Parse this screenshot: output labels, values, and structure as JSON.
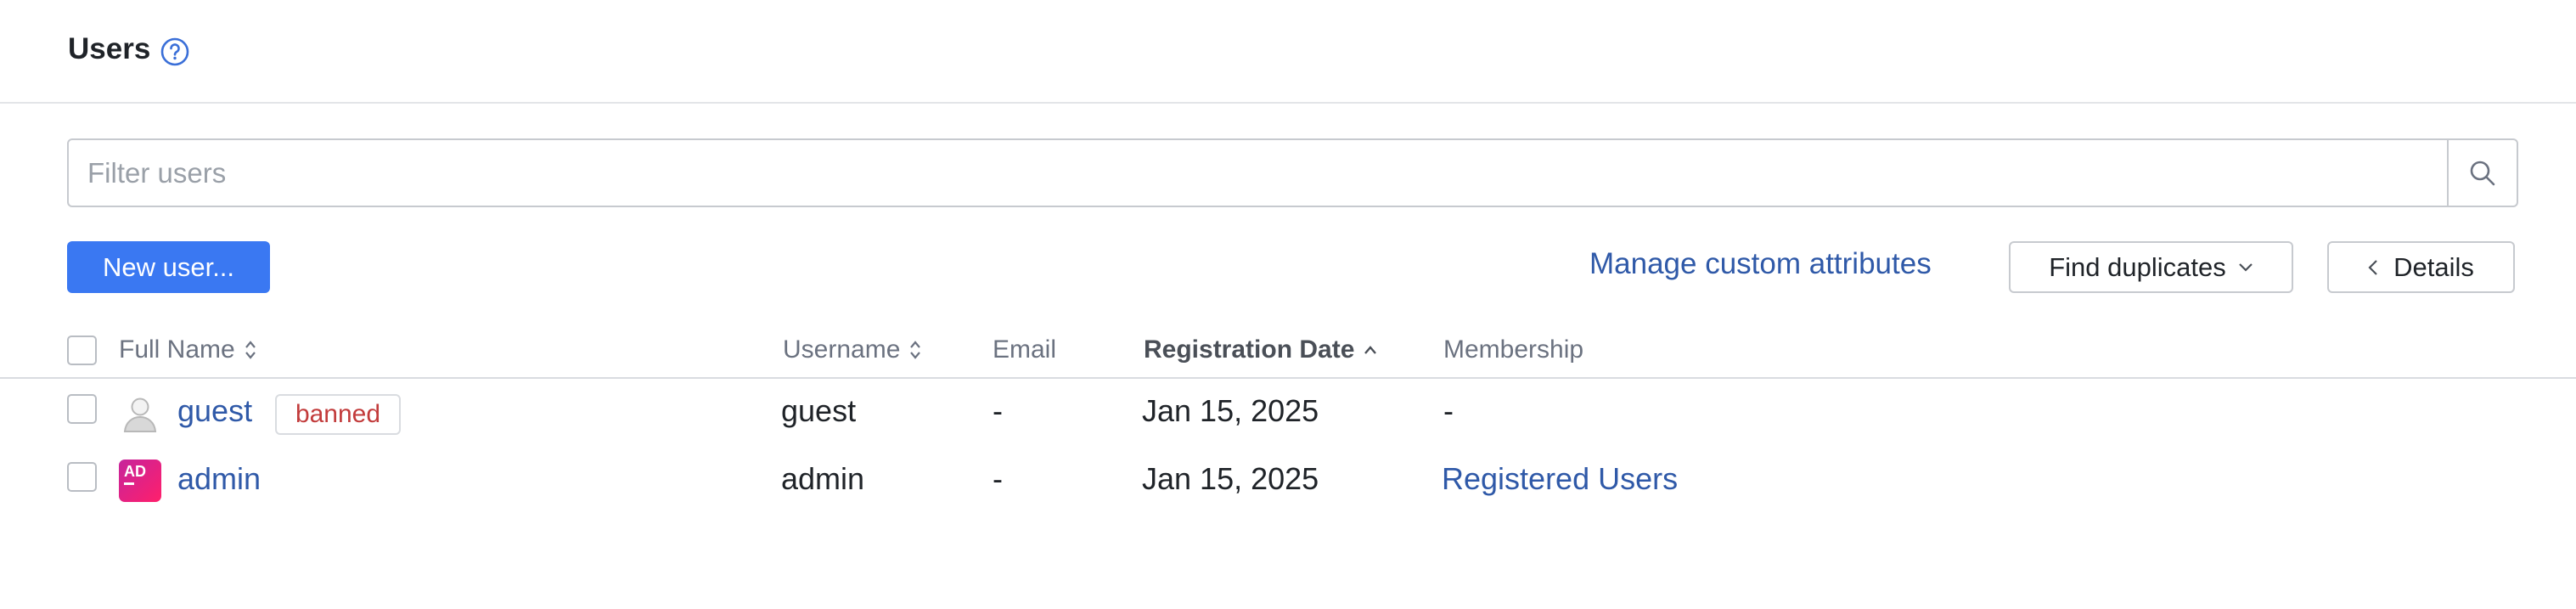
{
  "header": {
    "title": "Users",
    "help_icon": "question-circle-icon"
  },
  "filter": {
    "placeholder": "Filter users",
    "value": "",
    "search_icon": "search-icon"
  },
  "toolbar": {
    "new_user_label": "New user...",
    "manage_attributes_label": "Manage custom attributes",
    "find_duplicates_label": "Find duplicates",
    "details_label": "Details"
  },
  "table": {
    "columns": {
      "full_name": "Full Name",
      "username": "Username",
      "email": "Email",
      "registration_date": "Registration Date",
      "membership": "Membership"
    },
    "sorted_column": "registration_date",
    "rows": [
      {
        "full_name": "guest",
        "badge": "banned",
        "avatar": "default-user-avatar",
        "username": "guest",
        "email": "-",
        "registration_date": "Jan 15, 2025",
        "membership": "-"
      },
      {
        "full_name": "admin",
        "avatar_initials": "AD",
        "username": "admin",
        "email": "-",
        "registration_date": "Jan 15, 2025",
        "membership": "Registered Users"
      }
    ]
  },
  "colors": {
    "primary": "#3a78f2",
    "link": "#2f59a8",
    "badge_danger": "#c23b3b",
    "avatar_gradient_start": "#c6249c",
    "avatar_gradient_end": "#ff1f6b"
  }
}
